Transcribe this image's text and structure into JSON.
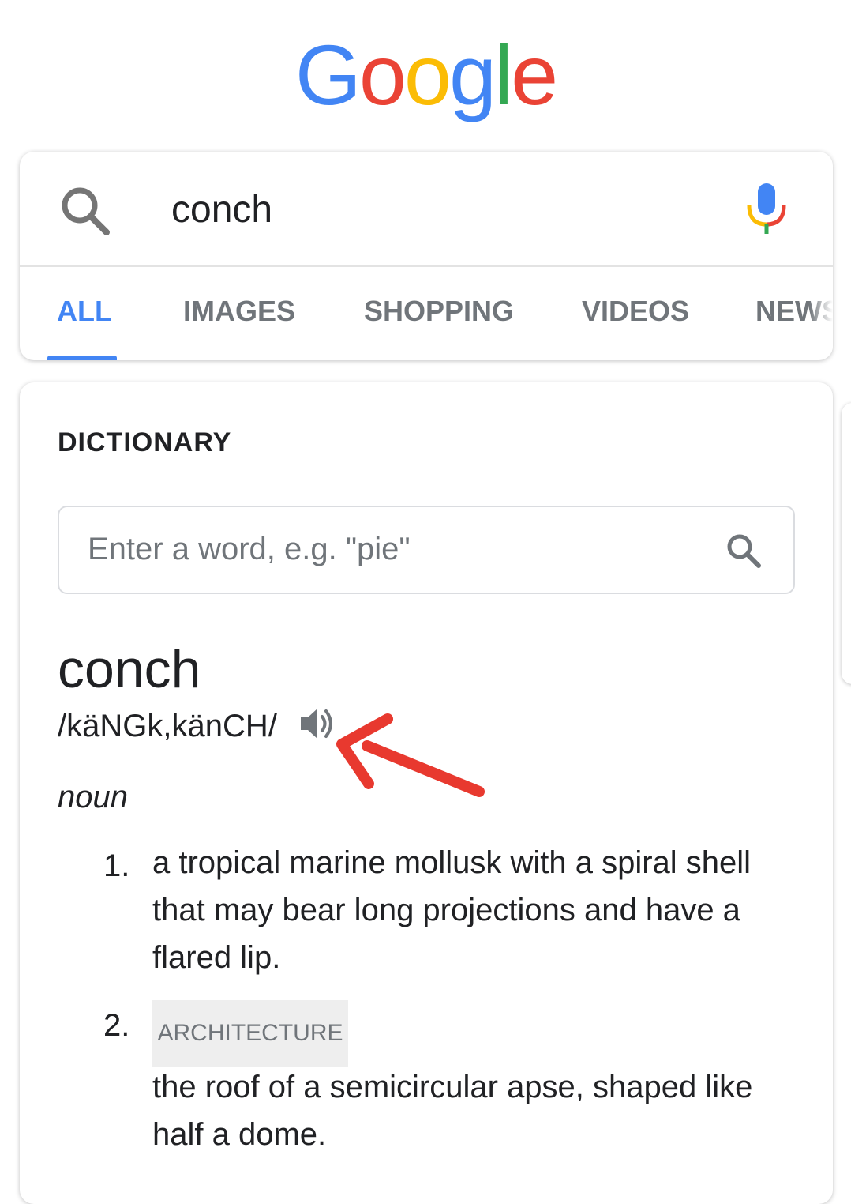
{
  "logo": {
    "letters": [
      {
        "char": "G",
        "color": "#4285f4"
      },
      {
        "char": "o",
        "color": "#ea4335"
      },
      {
        "char": "o",
        "color": "#fbbc05"
      },
      {
        "char": "g",
        "color": "#4285f4"
      },
      {
        "char": "l",
        "color": "#34a853"
      },
      {
        "char": "e",
        "color": "#ea4335"
      }
    ]
  },
  "search": {
    "query": "conch",
    "icons": {
      "left": "search-icon",
      "right": "mic-icon"
    }
  },
  "tabs": [
    {
      "label": "ALL",
      "active": true
    },
    {
      "label": "IMAGES",
      "active": false
    },
    {
      "label": "SHOPPING",
      "active": false
    },
    {
      "label": "VIDEOS",
      "active": false
    },
    {
      "label": "NEWS",
      "active": false
    }
  ],
  "dictionary": {
    "title": "DICTIONARY",
    "input_placeholder": "Enter a word, e.g. \"pie\"",
    "word": "conch",
    "pronunciation": "/käNGk,känCH/",
    "part_of_speech": "noun",
    "definitions": [
      {
        "number": "1.",
        "label": "",
        "text": "a tropical marine mollusk with a spiral shell that may bear long projections and have a flared lip."
      },
      {
        "number": "2.",
        "label": "ARCHITECTURE",
        "text": "the roof of a semicircular apse, shaped like half a dome."
      }
    ]
  },
  "colors": {
    "accent": "#4285f4",
    "tab_inactive": "#70757a",
    "annotation_arrow": "#e8392f"
  }
}
